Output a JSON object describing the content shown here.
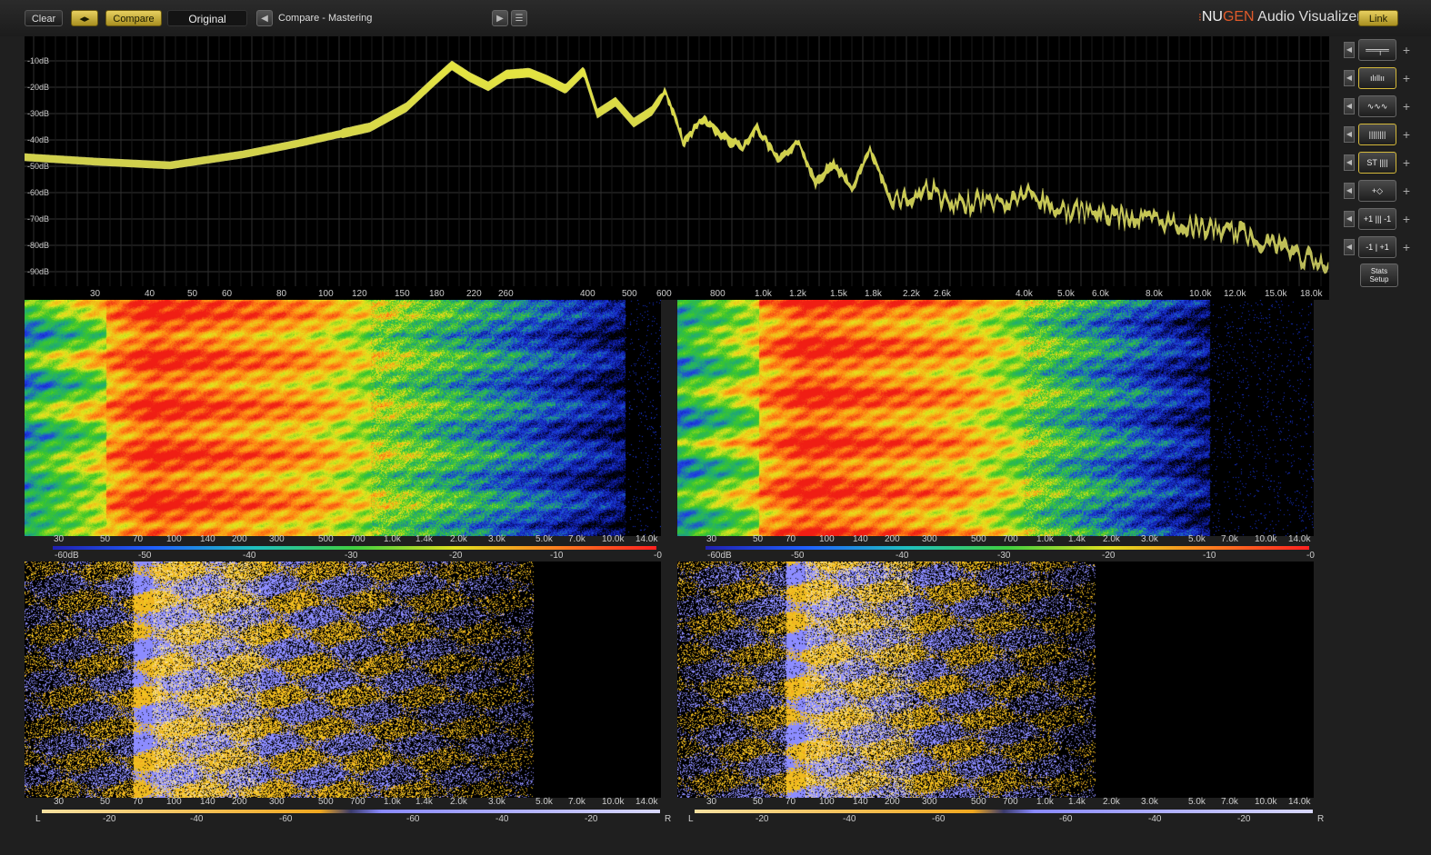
{
  "toolbar": {
    "clear_label": "Clear",
    "swap_icon": "swap-arrows-icon",
    "compare_label": "Compare",
    "mode_label": "Original",
    "preset_name": "Compare - Mastering",
    "prev_icon": "triangle-left-icon",
    "next_icon": "triangle-right-icon",
    "menu_icon": "list-icon",
    "link_label": "Link"
  },
  "brand": {
    "prefix": "NU",
    "accent": "GEN",
    "product": " Audio Visualizer"
  },
  "spectrum": {
    "db_labels": [
      "-10dB",
      "-20dB",
      "-30dB",
      "-40dB",
      "-50dB",
      "-60dB",
      "-70dB",
      "-80dB",
      "-90dB"
    ],
    "freq_labels": [
      "30",
      "40",
      "50",
      "60",
      "80",
      "100",
      "120",
      "150",
      "180",
      "220",
      "260",
      "400",
      "500",
      "600",
      "800",
      "1.0k",
      "1.2k",
      "1.5k",
      "1.8k",
      "2.2k",
      "2.6k",
      "4.0k",
      "5.0k",
      "6.0k",
      "8.0k",
      "10.0k",
      "12.0k",
      "15.0k",
      "18.0k"
    ]
  },
  "sonogram": {
    "freq_labels": [
      "30",
      "50",
      "70",
      "100",
      "140",
      "200",
      "300",
      "500",
      "700",
      "1.0k",
      "1.4k",
      "2.0k",
      "3.0k",
      "5.0k",
      "7.0k",
      "10.0k",
      "14.0k"
    ],
    "scale_labels": [
      "-60dB",
      "-50",
      "-40",
      "-30",
      "-20",
      "-10",
      "-0"
    ]
  },
  "stereo": {
    "freq_labels": [
      "30",
      "50",
      "70",
      "100",
      "140",
      "200",
      "300",
      "500",
      "700",
      "1.0k",
      "1.4k",
      "2.0k",
      "3.0k",
      "5.0k",
      "7.0k",
      "10.0k",
      "14.0k"
    ],
    "left_label": "L",
    "right_label": "R",
    "scale_labels": [
      "-20",
      "-40",
      "-60",
      "-60",
      "-40",
      "-20"
    ]
  },
  "sidebar": {
    "buttons": [
      {
        "icon": "stereo-bar-icon",
        "text": "══╤═"
      },
      {
        "icon": "bars-icon",
        "text": "ılıllıı"
      },
      {
        "icon": "waveform-icon",
        "text": "∿∿∿"
      },
      {
        "icon": "histogram-icon",
        "text": "||||||||"
      },
      {
        "icon": "stereo-hist-icon",
        "text": "ST ||||"
      },
      {
        "icon": "vectorscope-icon",
        "text": "+◇"
      },
      {
        "icon": "correlation-icon",
        "text": "+1 ||| -1"
      },
      {
        "icon": "balance-icon",
        "text": "-1 | +1"
      }
    ],
    "stats_label_1": "Stats",
    "stats_label_2": "Setup"
  },
  "colors": {
    "accent": "#d4b83a",
    "spectrum_line": "#b8b85a",
    "spectrum_top": "#e6e640",
    "stereo_left": "#f0a820",
    "stereo_right": "#8a8aff"
  }
}
